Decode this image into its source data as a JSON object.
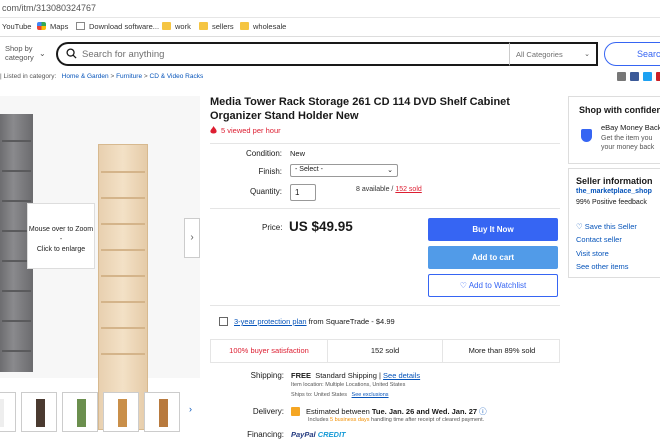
{
  "browser": {
    "url": "com/itm/313080324767",
    "bookmarks": [
      "YouTube",
      "Maps",
      "Download software...",
      "work",
      "sellers",
      "wholesale"
    ]
  },
  "header": {
    "shop_by_line1": "Shop by",
    "shop_by_line2": "category",
    "search_placeholder": "Search for anything",
    "category_select": "All Categories",
    "search_button": "Search"
  },
  "breadcrumb": {
    "prefix": "| Listed in category:",
    "items": [
      "Home & Garden",
      "Furniture",
      "CD & Video Racks"
    ],
    "separator": ">"
  },
  "gallery": {
    "zoom_hint_line1": "Mouse over to Zoom",
    "zoom_hint_sep": "-",
    "zoom_hint_line2": "Click to enlarge",
    "next_arrow": "›",
    "thumbs_more": "›"
  },
  "item": {
    "title": "Media Tower Rack Storage 261 CD 114 DVD Shelf Cabinet Organizer Stand Holder New",
    "viewed": "5 viewed per hour",
    "condition_label": "Condition:",
    "condition_value": "New",
    "finish_label": "Finish:",
    "finish_value": "- Select -",
    "quantity_label": "Quantity:",
    "quantity_value": "1",
    "available": "8 available /",
    "sold_link": "152 sold",
    "price_label": "Price:",
    "price": "US $49.95",
    "buy_now": "Buy It Now",
    "add_to_cart": "Add to cart",
    "add_to_watchlist": "♡ Add to Watchlist",
    "protection_link": "3-year protection plan",
    "protection_rest": "from SquareTrade - $4.99",
    "stat_satisfaction": "100% buyer satisfaction",
    "stat_sold": "152 sold",
    "stat_more": "More than 89% sold",
    "shipping_label": "Shipping:",
    "shipping_free": "FREE",
    "shipping_method": "Standard Shipping |",
    "shipping_details": "See details",
    "item_location": "Item location:  Multiple Locations, United States",
    "ships_to": "Ships to:  United States",
    "see_exclusions": "See exclusions",
    "delivery_label": "Delivery:",
    "delivery_prefix": "Estimated between",
    "delivery_dates": "Tue. Jan. 26 and Wed. Jan. 27",
    "delivery_note_pre": "Includes",
    "delivery_note_hl": "5 business days",
    "delivery_note_post": "handling time after receipt of cleared payment.",
    "financing_label": "Financing:",
    "paypal_1": "PayPal",
    "paypal_2": "CREDIT"
  },
  "sidebar": {
    "confidence_title": "Shop with confidence",
    "guarantee_title": "eBay Money Back",
    "guarantee_line1": "Get the item you",
    "guarantee_line2": "your money back",
    "seller_title": "Seller information",
    "seller_name": "the_marketplace_shop",
    "feedback": "99% Positive feedback",
    "save_seller": "♡ Save this Seller",
    "contact_seller": "Contact seller",
    "visit_store": "Visit store",
    "other_items": "See other items"
  },
  "colors": {
    "accent": "#3665f3",
    "link": "#0654ba",
    "alert": "#dd1e31"
  }
}
